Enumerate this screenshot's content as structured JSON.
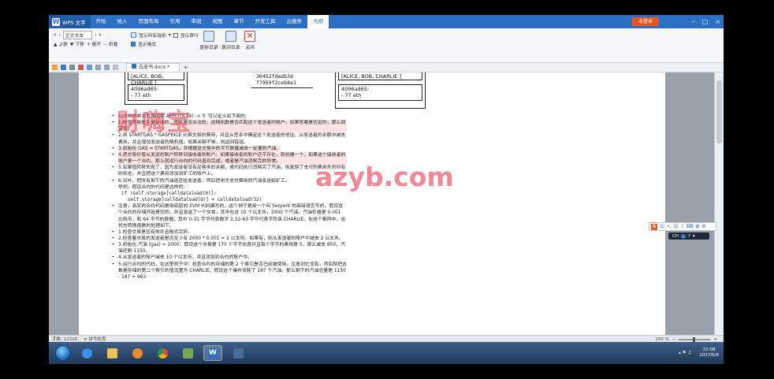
{
  "app": {
    "name": "WPS 文字",
    "login": "未登录"
  },
  "menu_tabs": [
    "开始",
    "插入",
    "页面布局",
    "引用",
    "审阅",
    "视图",
    "章节",
    "开发工具",
    "云服务",
    "大纲"
  ],
  "active_menu_tab": "大纲",
  "ribbon": {
    "outline_level": "正文文本",
    "show_level": "显示所有级别",
    "show_first_line": "显示首行",
    "show_format": "显示格式",
    "up": "上移",
    "down": "下移",
    "expand": "展开",
    "collapse": "折叠",
    "update_toc": "更新目录",
    "goto_toc": "跳到目录",
    "close": "关闭"
  },
  "doc_tab": "白皮书.docx *",
  "diagram": {
    "left_names": "[ALICE, BOB, CHARLIE ]",
    "left_addr": "4096ad65:",
    "left_eth": "- 77 eth",
    "middle_line1": "30452fdedb3d",
    "middle_line2": "f7959f2ceb8a1",
    "right_names": "[ALICE, BOB, CHARLIE ]",
    "right_addr": "4096ad65:",
    "right_eth": "- 77 eth"
  },
  "body": [
    {
      "b": "•",
      "t": "以太坊的状态转换函数 APPLY(S,TX) -> S' 可以定义如下面的:"
    },
    {
      "b": "•",
      "t": "1.检查交易是否是合法的，签名是否合法的，这随机数是否匹配这个发送者的账户，如果答案是否定的，那么回错误。",
      "hl": true
    },
    {
      "b": "•",
      "t": "2.用 STARTGAS * GASPRICE 计算交易的费用，并且从签名中确定这个发送者的地址。从发送者的余额中减去费用，并且增加发送者的随机值。如果余额不够，则返回错误。"
    },
    {
      "b": "•",
      "t": "3.初始化 GAS = STARTGAS，并根据这交易中的字节数量减去一定量的汽油。",
      "hl": true
    },
    {
      "b": "•",
      "t": "4.把交易价值从发送的账户转移到接收者的账户。如果接收者的账户还不存在，就创建一个。如果这个接收者的账户是一个合约，那么就运行合约的代码直到完成，或者是汽油消耗完的异常。",
      "hl": true
    },
    {
      "b": "•",
      "t": "5.如果值转移失败了，因为发送者没有足够多的余额，或代码执行消耗完了汽油，恢复除了支付的费用外的所有的状态，并且把这个费用添加到矿工的账户上。"
    },
    {
      "b": "•",
      "t": "6.另外，把所有剩下的汽油退还给发送者，然后把用于支付费用的汽油发送给矿工。"
    },
    {
      "b": "",
      "t": "举例，假设合约的代码是这样的:"
    },
    {
      "b": "",
      "t": "if !self.storage[calldataload(0)]:",
      "mono": 1
    },
    {
      "b": "",
      "t": "self.storage[calldataload(0)] = calldataload(32)",
      "mono": 2
    },
    {
      "b": "•",
      "t": "注意，真实的合约代码是用底层的 EVM 代码编写的，这个例子是用一个叫 Serpent 的高级语言写的，假设这个合约的存储开始是空的，并且发送了一个交易，其中包含 10 个以太币，2000 个汽油，汽油价格是 0.001 比特币，和 64 字节的数据，其中 0-31 字节代表数字 2,32-63 字节代表字符串 CHARLIE。在这个案例中，这状态转换函数的处理如下。"
    },
    {
      "b": "•",
      "t": "1.检查交易是否有效并且格式完好。"
    },
    {
      "b": "•",
      "t": "2.检查着交易的发送者是否至少有 2000 * 0.001 = 2 以太币。如果有，则从发送者的账户中减去 2 以太币。"
    },
    {
      "b": "•",
      "t": "3.初始化 汽油 (gas) = 2000；假设这个交易是 170 个字节长度并且每个字节的费用是 5，那么减去 850，汽油还剩 1150。"
    },
    {
      "b": "•",
      "t": "4.从发送者的账户减去 10 个以太币，并且添加到合约的账户中。"
    },
    {
      "b": "•",
      "t": "5.运行合约的代码，在这里例子中：检查合约的存储的第 2 个索引是否已经被使用，注意到它没有，然后就把这数据存储的第二个索引的值设置为 CHARLIE。假设这个操作消耗了 187 个汽油，那么剩下的汽油总量是 1150 - 187 = 963"
    }
  ],
  "watermark": {
    "cn": "财嗨宝",
    "url": "azyb.com"
  },
  "ime": {
    "label": "中",
    "lang": "CH"
  },
  "status": {
    "left": "字数: 12316",
    "check": "拼写检查",
    "zoom": "100 %"
  },
  "tray": {
    "time": "22:08",
    "date": "2017/6/8"
  },
  "colors": {
    "titlebar": "#2d6fc4",
    "login": "#e9531f",
    "watermark": "#e73c4c"
  }
}
